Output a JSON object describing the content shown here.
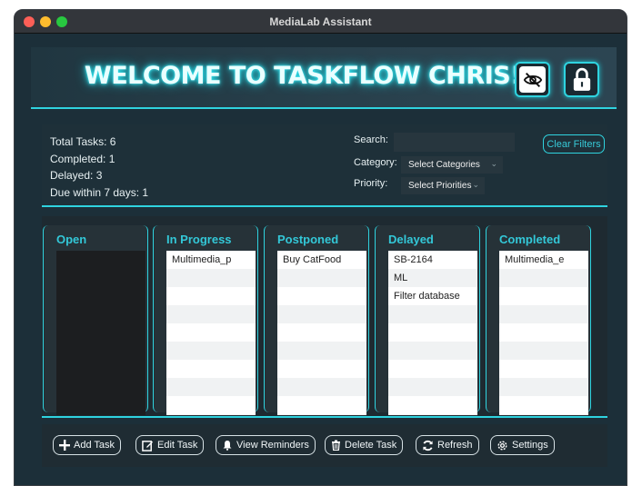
{
  "window": {
    "title": "MediaLab Assistant"
  },
  "header": {
    "welcome": "WELCOME TO TASKFLOW CHRIS!"
  },
  "stats": {
    "total": "Total Tasks: 6",
    "completed": "Completed: 1",
    "delayed": "Delayed: 3",
    "due": "Due within 7 days: 1"
  },
  "filters": {
    "search_label": "Search:",
    "search_value": "",
    "category_label": "Category:",
    "category_value": "Select Categories",
    "priority_label": "Priority:",
    "priority_value": "Select Priorities",
    "clear_label": "Clear Filters"
  },
  "columns": [
    {
      "title": "Open",
      "items": []
    },
    {
      "title": "In Progress",
      "items": [
        "Multimedia_p"
      ]
    },
    {
      "title": "Postponed",
      "items": [
        "Buy CatFood"
      ]
    },
    {
      "title": "Delayed",
      "items": [
        "SB-2164",
        "ML",
        "Filter database"
      ]
    },
    {
      "title": "Completed",
      "items": [
        "Multimedia_e"
      ]
    }
  ],
  "footer": {
    "add": "Add Task",
    "edit": "Edit Task",
    "reminders": "View Reminders",
    "delete": "Delete Task",
    "refresh": "Refresh",
    "settings": "Settings"
  },
  "colors": {
    "accent": "#2fd3df",
    "background": "#1c2f39"
  }
}
